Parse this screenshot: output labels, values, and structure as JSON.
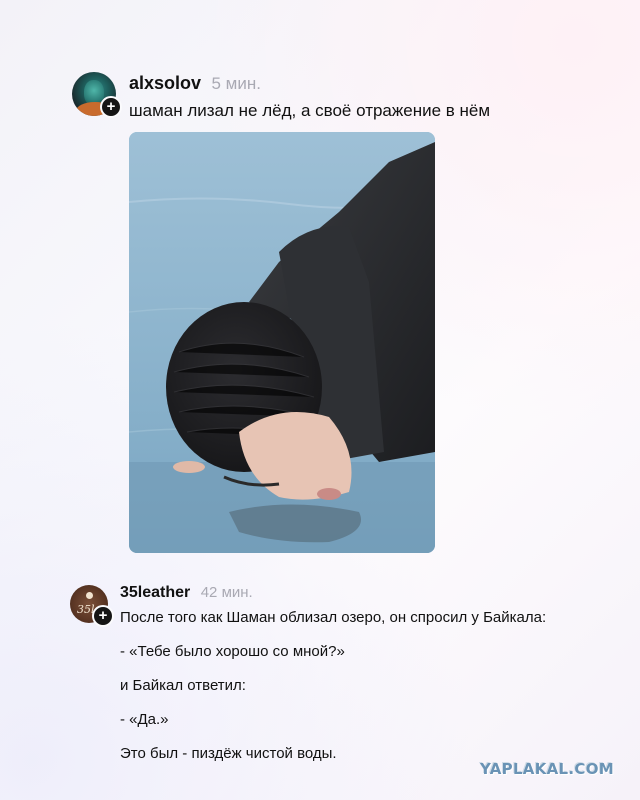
{
  "posts": [
    {
      "username": "alxsolov",
      "time": "5 мин.",
      "text": "шаман лизал не лёд, а своё отражение в нём",
      "avatar_icon": "user-avatar",
      "follow_icon": "plus-icon",
      "image": "photo of a man in a black beanie licking ice"
    },
    {
      "username": "35leather",
      "time": "42 мин.",
      "avatar_icon": "brand-logo-avatar",
      "avatar_logo_text": "35le",
      "follow_icon": "plus-icon",
      "lines": [
        "После того как Шаман облизал озеро, он спросил у Байкала:",
        "- «Тебе было хорошо со мной?»",
        "и Байкал ответил:",
        "- «Да.»",
        "Это был - пиздёж чистой воды."
      ]
    }
  ],
  "watermark": "YAPLAKAL.COM",
  "colors": {
    "background": "#f6f5fa",
    "username": "#111111",
    "timestamp": "#a9a9b3",
    "watermark": "#6a93b5"
  }
}
